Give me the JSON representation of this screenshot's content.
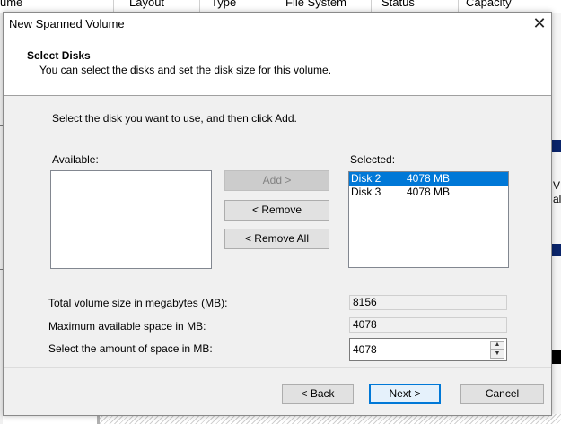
{
  "background": {
    "columns": [
      "ume",
      "Layout",
      "Type",
      "File System",
      "Status",
      "Capacity"
    ],
    "right_edge_text": [
      "V",
      "al"
    ]
  },
  "dialog": {
    "title": "New Spanned Volume",
    "close_symbol": "✕",
    "header": {
      "title": "Select Disks",
      "subtitle": "You can select the disks and set the disk size for this volume."
    },
    "instruction": "Select the disk you want to use, and then click Add.",
    "available_label": "Available:",
    "selected_label": "Selected:",
    "available_items": [],
    "selected_items": [
      {
        "disk": "Disk 2",
        "size": "4078 MB",
        "selected": true
      },
      {
        "disk": "Disk 3",
        "size": "4078 MB",
        "selected": false
      }
    ],
    "buttons": {
      "add": "Add >",
      "remove": "< Remove",
      "remove_all": "< Remove All"
    },
    "fields": {
      "total_label": "Total volume size in megabytes (MB):",
      "total_value": "8156",
      "max_label": "Maximum available space in MB:",
      "max_value": "4078",
      "amount_label": "Select the amount of space in MB:",
      "amount_value": "4078"
    },
    "footer": {
      "back": "< Back",
      "next": "Next >",
      "cancel": "Cancel"
    }
  },
  "colors": {
    "selection": "#0078d7",
    "body_bg": "#f0f0f0",
    "disabled_text": "#838383"
  }
}
